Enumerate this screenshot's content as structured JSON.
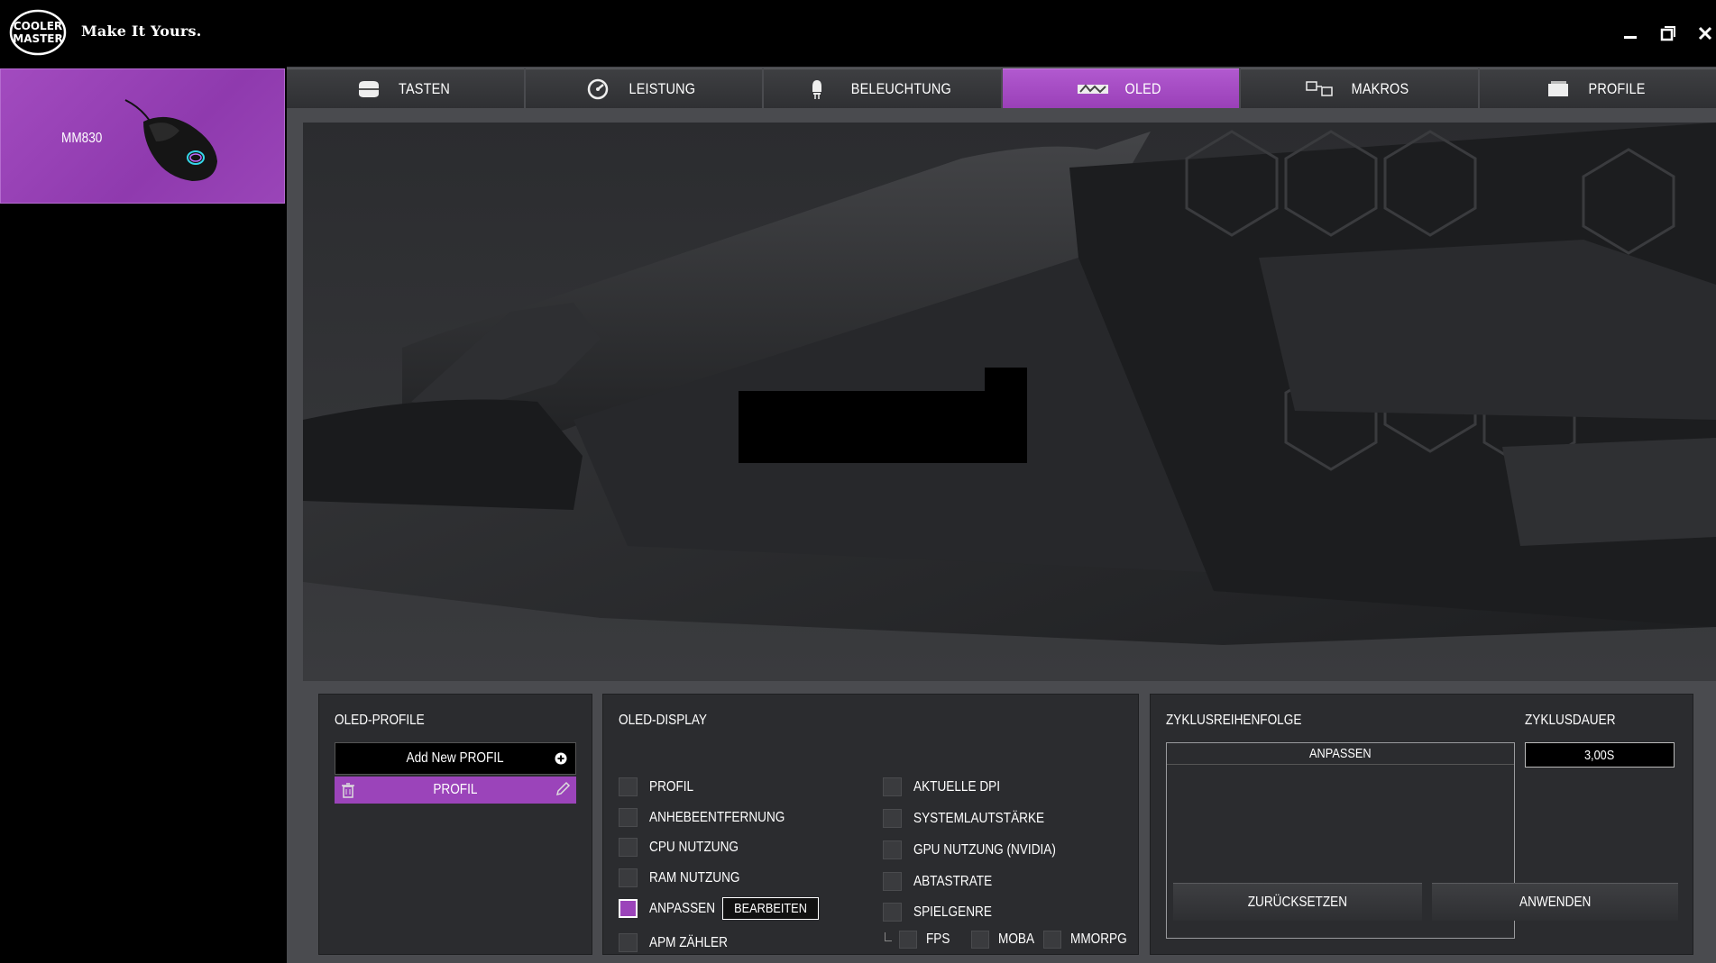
{
  "app": {
    "tagline": "Make It Yours."
  },
  "window": {
    "minimize": "minimize",
    "restore": "restore",
    "close": "close"
  },
  "device": {
    "name": "MM830"
  },
  "tabs": [
    {
      "label": "TASTEN",
      "icon": "keys-icon"
    },
    {
      "label": "LEISTUNG",
      "icon": "performance-gauge-icon"
    },
    {
      "label": "BELEUCHTUNG",
      "icon": "lighting-bulb-icon"
    },
    {
      "label": "OLED",
      "icon": "oled-display-icon",
      "active": true
    },
    {
      "label": "MAKROS",
      "icon": "macros-icon"
    },
    {
      "label": "PROFILE",
      "icon": "profile-folder-icon"
    }
  ],
  "oled_profiles": {
    "title": "OLED-PROFILE",
    "add_label": "Add New PROFIL",
    "items": [
      {
        "label": "PROFIL"
      }
    ]
  },
  "oled_display": {
    "title": "OLED-DISPLAY",
    "left": [
      {
        "label": "PROFIL",
        "checked": false
      },
      {
        "label": "ANHEBEENTFERNUNG",
        "checked": false
      },
      {
        "label": "CPU NUTZUNG",
        "checked": false
      },
      {
        "label": "RAM NUTZUNG",
        "checked": false
      },
      {
        "label": "ANPASSEN",
        "checked": true
      },
      {
        "label": "APM ZÄHLER",
        "checked": false
      }
    ],
    "edit_label": "BEARBEITEN",
    "right": [
      {
        "label": "AKTUELLE DPI",
        "checked": false
      },
      {
        "label": "SYSTEMLAUTSTÄRKE",
        "checked": false
      },
      {
        "label": "GPU NUTZUNG (NVIDIA)",
        "checked": false
      },
      {
        "label": "ABTASTRATE",
        "checked": false
      },
      {
        "label": "SPIELGENRE",
        "checked": false
      }
    ],
    "genres": [
      {
        "label": "FPS",
        "checked": false
      },
      {
        "label": "MOBA",
        "checked": false
      },
      {
        "label": "MMORPG",
        "checked": false
      }
    ]
  },
  "cycle": {
    "order_title": "ZYKLUSREIHENFOLGE",
    "duration_title": "ZYKLUSDAUER",
    "list_header": "ANPASSEN",
    "duration_value": "3,00S",
    "reset_label": "ZURÜCKSETZEN",
    "apply_label": "ANWENDEN"
  },
  "colors": {
    "accent": "#9b44ba",
    "panel": "#2b2c2f",
    "background": "#4a4b4f"
  }
}
